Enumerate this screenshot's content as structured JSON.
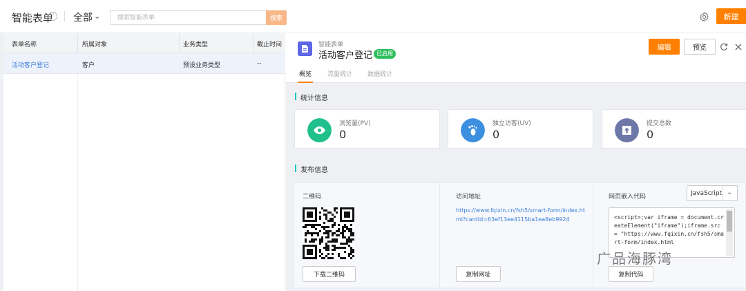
{
  "header": {
    "title": "智能表单",
    "filter_label": "全部",
    "search_placeholder": "搜索智能表单",
    "search_button": "搜索",
    "new_button": "新建"
  },
  "table": {
    "columns": [
      "表单名称",
      "所属对象",
      "业务类型",
      "截止时间"
    ],
    "rows": [
      [
        "活动客户登记",
        "客户",
        "预设业务类型",
        "--"
      ]
    ]
  },
  "detail": {
    "subtitle": "智能表单",
    "name": "活动客户登记",
    "status": "已启用",
    "edit_button": "编辑",
    "preview_button": "预览",
    "tabs": [
      "概览",
      "流量统计",
      "数据统计"
    ],
    "stats_title": "统计信息",
    "stats": [
      {
        "label": "浏览量(PV)",
        "value": "0"
      },
      {
        "label": "独立访客(UV)",
        "value": "0"
      },
      {
        "label": "提交总数",
        "value": "0"
      }
    ],
    "publish_title": "发布信息",
    "qr_label": "二维码",
    "qr_button": "下载二维码",
    "url_label": "访问地址",
    "url": "https://www.fqixin.cn/fsh5/smart-form/index.html?cardId=63ef13ee4115ba1ea8eb9924",
    "url_button": "复制网址",
    "embed_label": "网页嵌入代码",
    "embed_lang": "JavaScript",
    "embed_code": "<script>;var iframe = document.createElement(\"iframe\");iframe.src = \"https://www.fqixin.cn/fsh5/smart-form/index.html",
    "embed_button": "复制代码"
  },
  "watermark": "广品海豚湾",
  "colors": {
    "accent": "#ff8000",
    "link": "#3b7fd9",
    "pv": "#1fc08c",
    "uv": "#3d8fe0",
    "submit": "#6d78a8",
    "status": "#2fbf5e"
  }
}
